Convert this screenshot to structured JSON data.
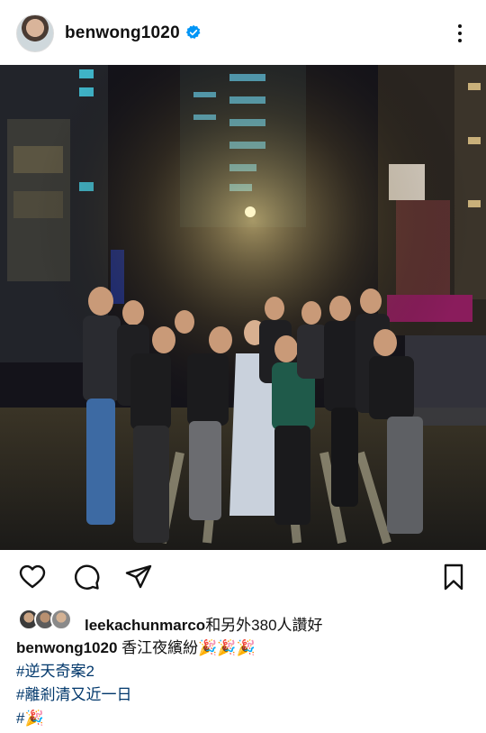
{
  "post": {
    "username": "benwong1020",
    "verified": true,
    "photo_alt": ""
  },
  "actions": {
    "like_icon": "heart-icon",
    "comment_icon": "comment-icon",
    "share_icon": "send-icon",
    "save_icon": "bookmark-icon"
  },
  "likes": {
    "user": "leekachunmarco",
    "rest": "和另外380人讚好"
  },
  "caption": {
    "username": "benwong1020",
    "text": "香江夜繽紛🎉🎉🎉",
    "hashtag1": "#逆天奇案2",
    "hashtag2": "#離剎清又近一日",
    "hashtag3": "#🎉"
  },
  "colors": {
    "verified_blue": "#0095f6",
    "hashtag_blue": "#00376b"
  }
}
